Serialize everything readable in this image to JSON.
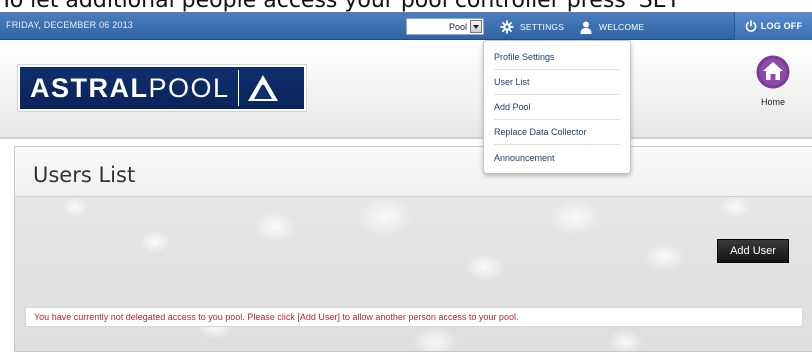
{
  "caption": "To let additional people access your pool controller press 'SET",
  "topbar": {
    "date": "FRIDAY, DECEMBER 06 2013",
    "pool_select_value": "Pool",
    "settings_label": "SETTINGS",
    "welcome_label": "WELCOME",
    "logoff_label": "LOG OFF"
  },
  "header": {
    "logo_bold": "ASTRAL",
    "logo_light": "POOL",
    "home_label": "Home"
  },
  "settings_menu": {
    "items": [
      "Profile Settings",
      "User List",
      "Add Pool",
      "Replace Data Collector",
      "Announcement"
    ]
  },
  "main": {
    "title": "Users List",
    "add_user_label": "Add User",
    "notice": "You have currently not delegated access to you pool. Please click [Add User] to allow another person access to your pool."
  },
  "colors": {
    "topbar": "#3a6eb0",
    "logo_bg": "#0f2f6e",
    "home_icon": "#7a3b96",
    "notice_text": "#b1272e",
    "menu_text": "#1c3f73"
  },
  "icons": [
    "gear-icon",
    "user-icon",
    "power-icon",
    "home-icon",
    "logo-triangle-icon"
  ]
}
